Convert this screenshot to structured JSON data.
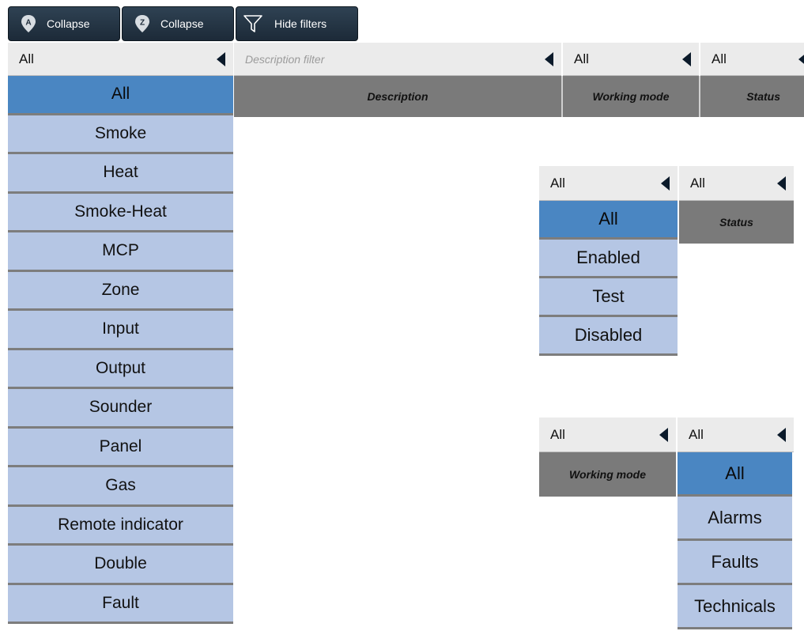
{
  "toolbar": {
    "collapse_a_label": "Collapse",
    "collapse_a_icon_letter": "A",
    "collapse_z_label": "Collapse",
    "collapse_z_icon_letter": "Z",
    "hide_filters_label": "Hide filters"
  },
  "type_filter": {
    "selected": "All",
    "options": [
      "All",
      "Smoke",
      "Heat",
      "Smoke-Heat",
      "MCP",
      "Zone",
      "Input",
      "Output",
      "Sounder",
      "Panel",
      "Gas",
      "Remote indicator",
      "Double",
      "Fault"
    ]
  },
  "description_filter": {
    "placeholder": "Description filter"
  },
  "working_mode_filter": {
    "selected": "All"
  },
  "status_filter": {
    "selected": "All"
  },
  "columns": {
    "description": "Description",
    "working_mode": "Working mode",
    "status": "Status"
  },
  "working_mode_dropdown": {
    "filter_selected": "All",
    "status_selected": "All",
    "options": [
      "All",
      "Enabled",
      "Test",
      "Disabled"
    ],
    "status_header": "Status"
  },
  "status_dropdown": {
    "filter_selected": "All",
    "working_mode_selected": "All",
    "working_mode_header": "Working mode",
    "options": [
      "All",
      "Alarms",
      "Faults",
      "Technicals"
    ]
  },
  "colors": {
    "toolbar_button": "#1c2a38",
    "filter_bar": "#ebebeb",
    "column_header": "#7a7a7a",
    "option_bg": "#b5c6e4",
    "option_selected": "#4a86c2",
    "arrow": "#0b1a2a"
  },
  "icons": {
    "collapse_a": "pin-a-icon",
    "collapse_z": "pin-z-icon",
    "hide_filters": "funnel-icon",
    "dropdown_arrow": "caret-left-icon"
  }
}
